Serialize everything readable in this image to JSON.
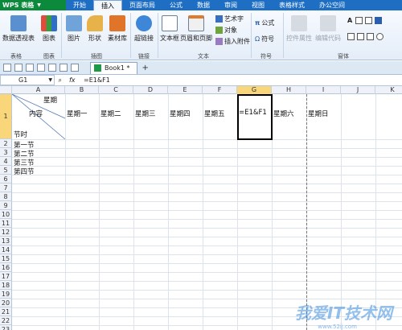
{
  "app": {
    "logo": "WPS 表格"
  },
  "menu": [
    "开始",
    "插入",
    "页面布局",
    "公式",
    "数据",
    "审阅",
    "视图",
    "表格样式",
    "办公空间"
  ],
  "menu_active": "插入",
  "ribbon": {
    "buttons": [
      "数据透视表",
      "图表",
      "图片",
      "形状",
      "素材库",
      "超链接",
      "文本框",
      "页眉和页脚"
    ],
    "small_buttons": [
      "艺术字",
      "对象",
      "插入附件"
    ],
    "formula": "公式",
    "symbol": "符号",
    "disabled": [
      "控件属性",
      "编辑代码"
    ],
    "groups": [
      "表格",
      "图表",
      "插图",
      "链接",
      "文本",
      "符号",
      "窗体"
    ]
  },
  "tab": {
    "name": "Book1 *",
    "add": "+"
  },
  "formula_bar": {
    "name_box": "G1",
    "fx": "fx",
    "value": "=E1&F1"
  },
  "columns": [
    "A",
    "B",
    "C",
    "D",
    "E",
    "F",
    "G",
    "H",
    "I",
    "J",
    "K"
  ],
  "rows": [
    "1",
    "2",
    "3",
    "4",
    "5",
    "6",
    "7",
    "8",
    "9",
    "10",
    "11",
    "12",
    "13",
    "14",
    "15",
    "16",
    "17",
    "18",
    "19",
    "20",
    "21",
    "22",
    "23"
  ],
  "sheet": {
    "a1_top": "星期",
    "a1_mid": "内容",
    "a1_bottom": "节时",
    "row1": [
      "星期一",
      "星期二",
      "星期三",
      "星期四",
      "星期五",
      "=E1&F1",
      "星期六",
      "星期日"
    ],
    "colA": [
      "第一节",
      "第二节",
      "第三节",
      "第四节"
    ]
  },
  "watermark": "我爱IT技术网",
  "watermark_sub": "www.52ij.com"
}
